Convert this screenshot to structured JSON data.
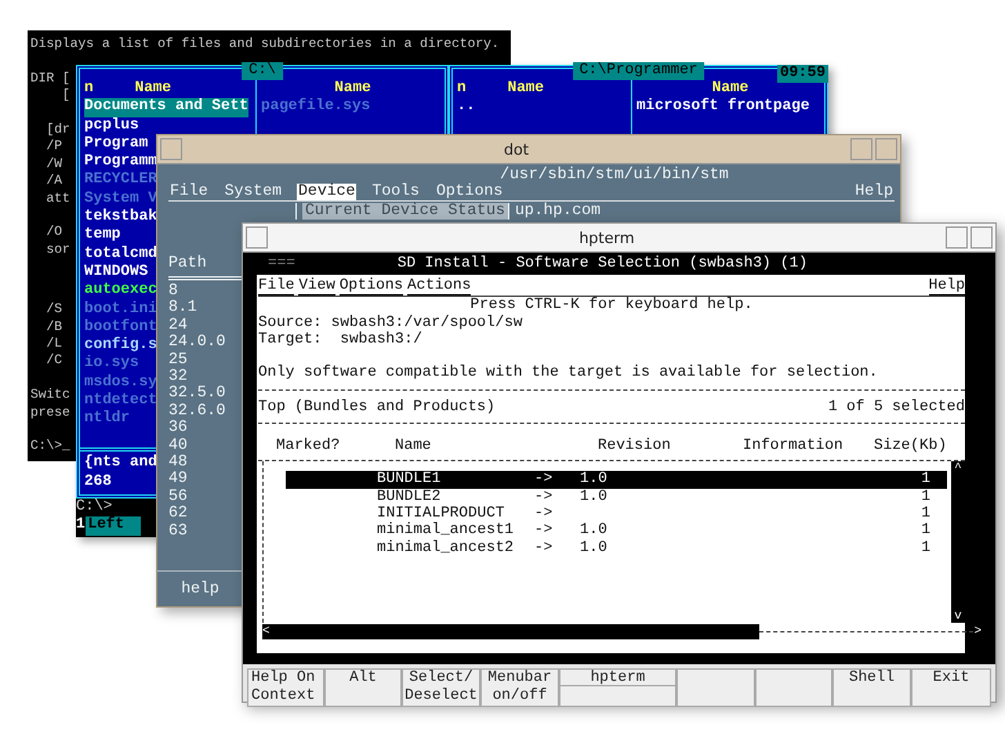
{
  "cmd_window": {
    "blocks": [
      [
        "Displays a list of files and subdirectories in a directory."
      ],
      [
        "DIR [",
        "    ["
      ],
      [
        "  [dr",
        "  /P",
        "  /W",
        "  /A",
        "  att"
      ],
      [
        "  /O",
        "  sor"
      ],
      [
        "  /S",
        "  /B",
        "  /L",
        "  /C"
      ],
      [
        "Switc",
        "prese"
      ],
      [
        "C:\\>_"
      ]
    ]
  },
  "commander_window": {
    "left_panel": {
      "title": "C:\\",
      "headers": [
        "n",
        "Name",
        "Name"
      ],
      "column_1": [
        {
          "name": "Documents and Sett",
          "kind": "dir",
          "selected": true
        },
        {
          "name": "pcplus",
          "kind": "dir",
          "selected": false
        },
        {
          "name": "Program",
          "kind": "dir",
          "selected": false
        },
        {
          "name": "Programm",
          "kind": "dir",
          "selected": false
        },
        {
          "name": "RECYCLER",
          "kind": "hidden",
          "selected": false
        },
        {
          "name": "System V",
          "kind": "hidden",
          "selected": false
        },
        {
          "name": "tekstbak",
          "kind": "dir",
          "selected": false
        },
        {
          "name": "temp",
          "kind": "dir",
          "selected": false
        },
        {
          "name": "totalcmd",
          "kind": "dir",
          "selected": false
        },
        {
          "name": "WINDOWS",
          "kind": "dir",
          "selected": false
        },
        {
          "name": "autoexec",
          "kind": "batch",
          "selected": false
        },
        {
          "name": "boot.ini",
          "kind": "hidden",
          "selected": false
        },
        {
          "name": "bootfont",
          "kind": "hidden",
          "selected": false
        },
        {
          "name": "config.s",
          "kind": "file",
          "selected": false
        },
        {
          "name": "io.sys",
          "kind": "hidden",
          "selected": false
        },
        {
          "name": "msdos.sy",
          "kind": "hidden",
          "selected": false
        },
        {
          "name": "ntdetect",
          "kind": "hidden",
          "selected": false
        },
        {
          "name": "ntldr",
          "kind": "hidden",
          "selected": false
        }
      ],
      "column_2": [
        {
          "name": "pagefile.sys",
          "kind": "hidden",
          "selected": false
        }
      ],
      "footer": [
        "{nts and",
        "268"
      ]
    },
    "right_panel": {
      "title": "C:\\Programmer",
      "clock": "09:59",
      "headers": [
        "n",
        "Name",
        "Name"
      ],
      "column_1": [
        {
          "name": "..",
          "kind": "dir",
          "selected": false
        }
      ],
      "column_2": [
        {
          "name": "microsoft frontpage",
          "kind": "dir",
          "selected": false
        }
      ]
    },
    "command_line": "C:\\>",
    "function_keys": [
      {
        "number": "1",
        "label": "Left"
      }
    ]
  },
  "dot_window": {
    "title": "dot",
    "path": "/usr/sbin/stm/ui/bin/stm",
    "menu": [
      {
        "label": "File",
        "selected": false
      },
      {
        "label": "System",
        "selected": false
      },
      {
        "label": "Device",
        "selected": true
      },
      {
        "label": "Tools",
        "selected": false
      },
      {
        "label": "Options",
        "selected": false
      }
    ],
    "help_menu": "Help",
    "dropdown_item": "Current Device Status",
    "host": "up.hp.com",
    "column_header": "Path",
    "paths": [
      "8",
      "8.1",
      "24",
      "24.0.0",
      "25",
      "32",
      "32.5.0",
      "32.6.0",
      "36",
      "40",
      "48",
      "49",
      "56",
      "62",
      "63"
    ],
    "help_button": "help"
  },
  "hpterm_window": {
    "title": "hpterm",
    "banner_mark": "===",
    "banner": "SD Install - Software Selection (swbash3) (1)",
    "menu": [
      "File",
      "View",
      "Options",
      "Actions"
    ],
    "help_menu": "Help",
    "hint": "Press CTRL-K for keyboard help.",
    "source": "Source: swbash3:/var/spool/sw",
    "target": "Target:  swbash3:/",
    "notice": "Only software compatible with the target is available for selection.",
    "level": "Top (Bundles and Products)",
    "selection_count": "1 of 5 selected",
    "columns": [
      "Marked?",
      "Name",
      "Revision",
      "Information",
      "Size(Kb)"
    ],
    "rows": [
      {
        "name": "BUNDLE1",
        "arrow": "->",
        "revision": "1.0",
        "size": "1",
        "selected": true
      },
      {
        "name": "BUNDLE2",
        "arrow": "->",
        "revision": "1.0",
        "size": "1",
        "selected": false
      },
      {
        "name": "INITIALPRODUCT",
        "arrow": "->",
        "size": "1",
        "selected": false
      },
      {
        "name": "minimal_ancest1",
        "arrow": "->",
        "revision": "1.0",
        "size": "1",
        "selected": false
      },
      {
        "name": "minimal_ancest2",
        "arrow": "->",
        "revision": "1.0",
        "size": "1",
        "selected": false
      }
    ],
    "scroll_up": "^",
    "scroll_down": "v",
    "scroll_left": "<",
    "scroll_right": ">",
    "function_keys": [
      {
        "kind": "key",
        "lines": [
          "Help On",
          "Context"
        ]
      },
      {
        "kind": "key",
        "lines": [
          "Alt"
        ]
      },
      {
        "kind": "key",
        "lines": [
          "Select/",
          "Deselect"
        ]
      },
      {
        "kind": "key",
        "lines": [
          "Menubar",
          "on/off"
        ]
      },
      {
        "kind": "label",
        "lines": [
          "hpterm"
        ]
      },
      {
        "kind": "blank"
      },
      {
        "kind": "blank"
      },
      {
        "kind": "key",
        "lines": [
          "Shell"
        ]
      },
      {
        "kind": "key",
        "lines": [
          "Exit"
        ]
      }
    ]
  }
}
